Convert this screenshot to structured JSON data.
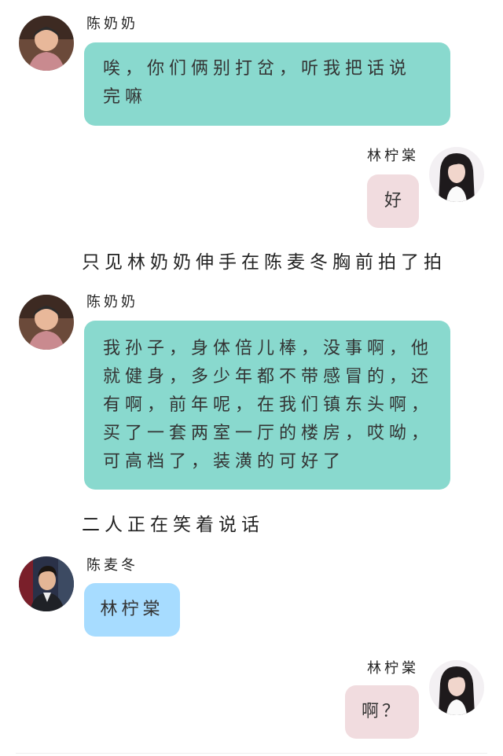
{
  "colors": {
    "teal_bubble": "#89d9ce",
    "pink_bubble": "#f1dcdf",
    "blue_bubble": "#a7dcff"
  },
  "messages": [
    {
      "speaker": "陈奶奶",
      "side": "left",
      "avatar_icon": "grandma-avatar",
      "text": "唉，你们俩别打岔，听我把话说完嘛"
    },
    {
      "speaker": "林柠棠",
      "side": "right",
      "avatar_icon": "girl-avatar",
      "text": "好"
    },
    {
      "narration": "只见林奶奶伸手在陈麦冬胸前拍了拍"
    },
    {
      "speaker": "陈奶奶",
      "side": "left",
      "avatar_icon": "grandma-avatar",
      "text": "我孙子，身体倍儿棒，没事啊，他就健身，多少年都不带感冒的，还有啊，前年呢，在我们镇东头啊，买了一套两室一厅的楼房，哎呦，可高档了，装潢的可好了"
    },
    {
      "narration": "二人正在笑着说话"
    },
    {
      "speaker": "陈麦冬",
      "side": "left",
      "avatar_icon": "young-man-avatar",
      "text": "林柠棠"
    },
    {
      "speaker": "林柠棠",
      "side": "right",
      "avatar_icon": "girl-avatar",
      "text": "啊？"
    }
  ]
}
